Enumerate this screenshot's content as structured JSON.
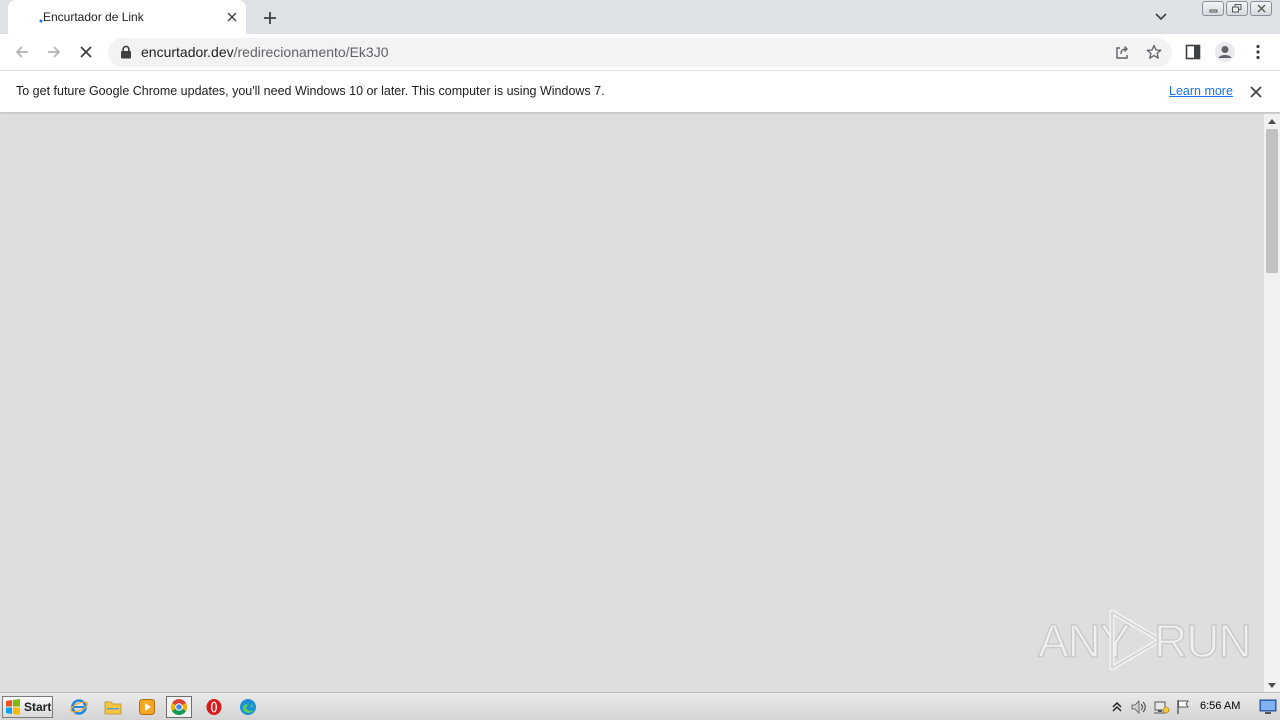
{
  "browser": {
    "tab": {
      "title": "Encurtador de Link",
      "loading": true
    },
    "address": {
      "domain": "encurtador.dev",
      "path": "/redirecionamento/Ek3J0"
    },
    "infobar": {
      "message": "To get future Google Chrome updates, you'll need Windows 10 or later. This computer is using Windows 7.",
      "link_label": "Learn more"
    }
  },
  "page": {
    "background": "#dedede"
  },
  "watermark": {
    "left_text": "ANY",
    "right_text": "RUN"
  },
  "taskbar": {
    "start_label": "Start",
    "pinned_apps": [
      "internet-explorer-icon",
      "file-explorer-icon",
      "media-player-icon",
      "chrome-icon",
      "opera-icon",
      "edge-icon"
    ],
    "active_app": "chrome-icon",
    "clock": "6:56 AM"
  },
  "colors": {
    "accent": "#1a73e8",
    "tabstrip": "#dee1e6",
    "chrome_red": "#db4437",
    "chrome_green": "#0f9d58",
    "chrome_yellow": "#f4b400"
  }
}
